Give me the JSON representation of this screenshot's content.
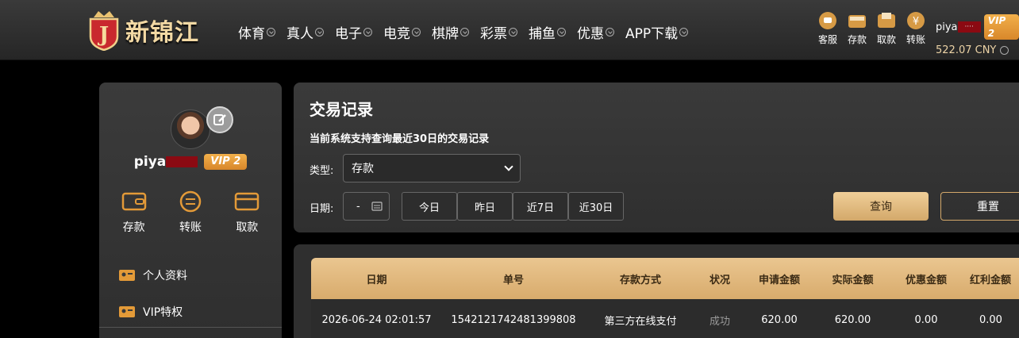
{
  "brand": {
    "name": "新锦江",
    "badge_letter": "J"
  },
  "nav": [
    {
      "label": "体育"
    },
    {
      "label": "真人"
    },
    {
      "label": "电子"
    },
    {
      "label": "电竞"
    },
    {
      "label": "棋牌"
    },
    {
      "label": "彩票"
    },
    {
      "label": "捕鱼"
    },
    {
      "label": "优惠"
    },
    {
      "label": "APP下载"
    }
  ],
  "quick_actions": [
    {
      "label": "客服",
      "icon": "chat-icon"
    },
    {
      "label": "存款",
      "icon": "wallet-icon"
    },
    {
      "label": "取款",
      "icon": "cash-icon"
    },
    {
      "label": "转账",
      "icon": "transfer-icon"
    }
  ],
  "header_user": {
    "name": "piya",
    "masked": "····",
    "vip": "VIP 2",
    "balance": "522.07 CNY"
  },
  "side": {
    "username": "piya",
    "vip": "VIP 2",
    "actions": [
      {
        "label": "存款",
        "icon": "wallet-icon"
      },
      {
        "label": "转账",
        "icon": "transfer-icon"
      },
      {
        "label": "取款",
        "icon": "card-icon"
      }
    ],
    "menu": [
      {
        "label": "个人资料",
        "icon": "id-card-icon"
      },
      {
        "label": "VIP特权",
        "icon": "vip-card-icon"
      }
    ]
  },
  "panel": {
    "title": "交易记录",
    "note": "当前系统支持查询最近30日的交易记录",
    "type_label": "类型:",
    "type_value": "存款",
    "date_label": "日期:",
    "date_value": "-",
    "quick_ranges": [
      "今日",
      "昨日",
      "近7日",
      "近30日"
    ],
    "query_label": "查询",
    "reset_label": "重置"
  },
  "table": {
    "headers": [
      "日期",
      "单号",
      "存款方式",
      "状况",
      "申请金额",
      "实际金额",
      "优惠金额",
      "红利金额"
    ],
    "rows": [
      [
        "2026-06-24 02:01:57",
        "1542121742481399808",
        "第三方在线支付",
        "成功",
        "620.00",
        "620.00",
        "0.00",
        "0.00"
      ]
    ]
  },
  "colors": {
    "accent_gold": "#d8ab6c",
    "vip_orange": "#e39a38",
    "redact": "#8b0a12"
  }
}
